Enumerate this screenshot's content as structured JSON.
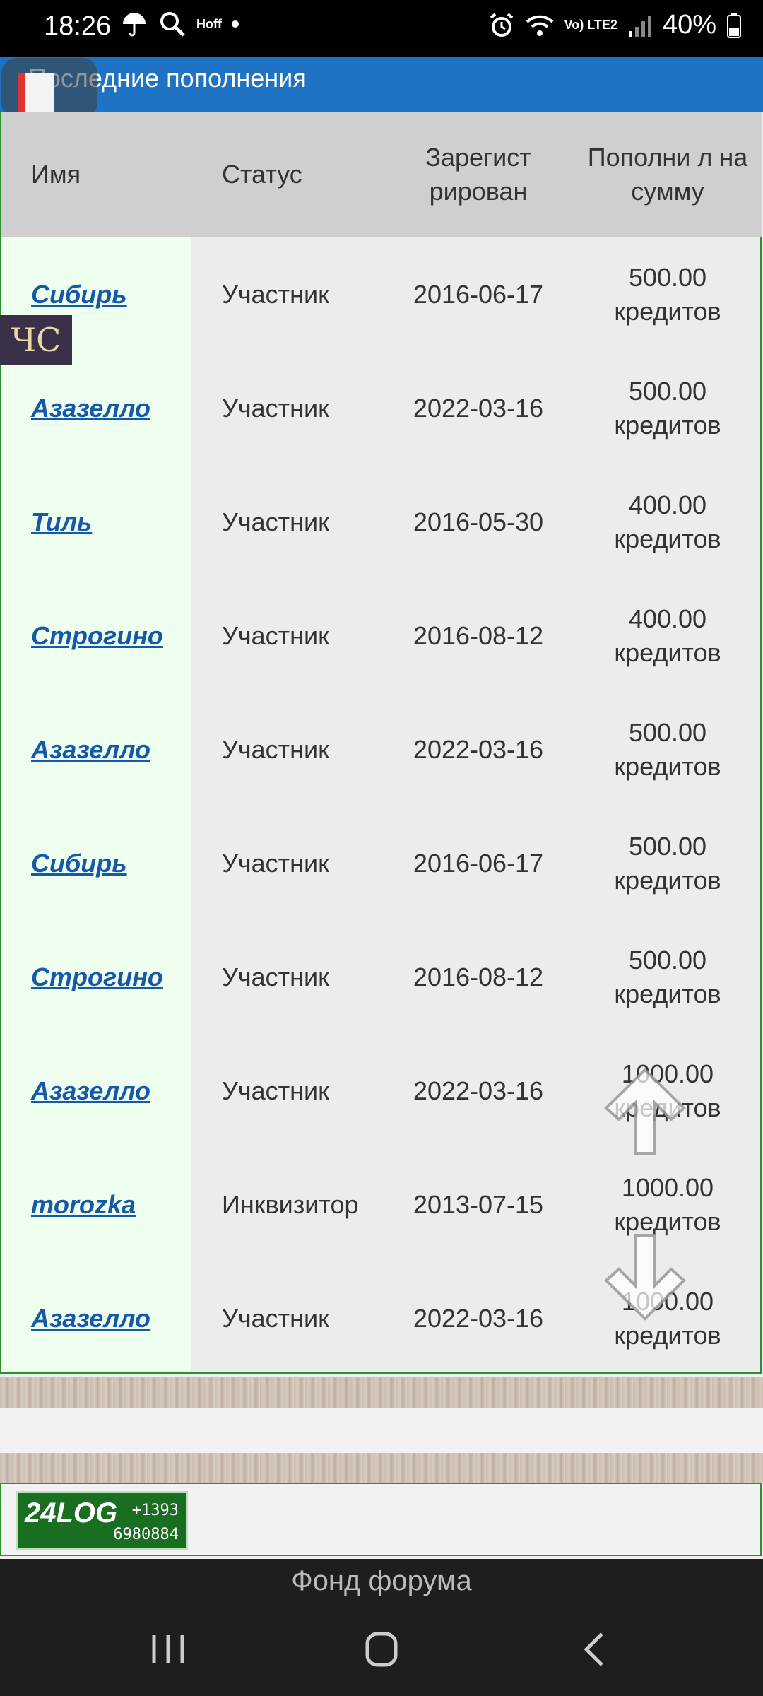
{
  "status_bar": {
    "time": "18:26",
    "carrier_tag": "Hoff",
    "volte": "Vo) LTE2",
    "battery": "40%"
  },
  "header": {
    "title": "Последние пополнения"
  },
  "floating_tag": "ЧС",
  "table": {
    "headers": {
      "name": "Имя",
      "status": "Статус",
      "registered": "Зарегист рирован",
      "amount": "Пополни л на сумму"
    },
    "rows": [
      {
        "name": "Сибирь",
        "status": "Участник",
        "date": "2016-06-17",
        "amount": "500.00 кредитов"
      },
      {
        "name": "Азазелло",
        "status": "Участник",
        "date": "2022-03-16",
        "amount": "500.00 кредитов"
      },
      {
        "name": "Тиль",
        "status": "Участник",
        "date": "2016-05-30",
        "amount": "400.00 кредитов"
      },
      {
        "name": "Строгино",
        "status": "Участник",
        "date": "2016-08-12",
        "amount": "400.00 кредитов"
      },
      {
        "name": "Азазелло",
        "status": "Участник",
        "date": "2022-03-16",
        "amount": "500.00 кредитов"
      },
      {
        "name": "Сибирь",
        "status": "Участник",
        "date": "2016-06-17",
        "amount": "500.00 кредитов"
      },
      {
        "name": "Строгино",
        "status": "Участник",
        "date": "2016-08-12",
        "amount": "500.00 кредитов"
      },
      {
        "name": "Азазелло",
        "status": "Участник",
        "date": "2022-03-16",
        "amount": "1000.00 кредитов"
      },
      {
        "name": "morozka",
        "status": "Инквизитор",
        "date": "2013-07-15",
        "amount": "1000.00 кредитов"
      },
      {
        "name": "Азазелло",
        "status": "Участник",
        "date": "2022-03-16",
        "amount": "1000.00 кредитов"
      }
    ]
  },
  "counter": {
    "brand": "24LOG",
    "line1": "+1393",
    "line2": "6980884"
  },
  "footer": {
    "title": "Фонд форума"
  },
  "icons": {
    "umbrella": "umbrella-icon",
    "search": "search-icon",
    "alarm": "alarm-icon",
    "wifi": "wifi-icon",
    "signal": "signal-icon",
    "battery": "battery-icon",
    "scroll_up": "scroll-up-icon",
    "scroll_down": "scroll-down-icon",
    "recents": "recents-icon",
    "home": "home-icon",
    "back": "back-icon"
  },
  "colors": {
    "header": "#1f73c4",
    "link": "#1659a8",
    "border": "#2f8f2f"
  }
}
